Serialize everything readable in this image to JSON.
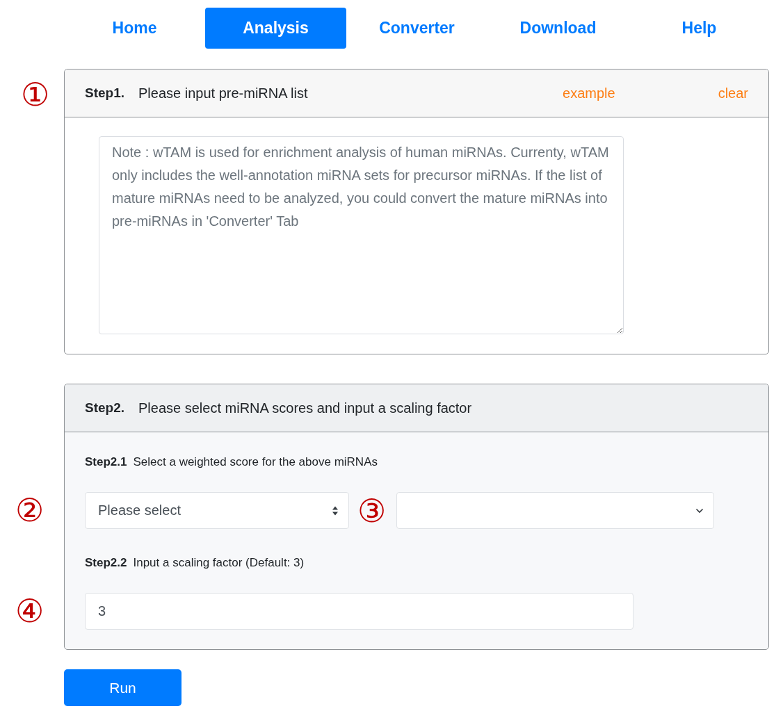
{
  "nav": {
    "tabs": [
      {
        "label": "Home",
        "selected": false
      },
      {
        "label": "Analysis",
        "selected": true
      },
      {
        "label": "Converter",
        "selected": false
      },
      {
        "label": "Download",
        "selected": false
      },
      {
        "label": "Help",
        "selected": false
      }
    ]
  },
  "step1": {
    "marker": "①",
    "step": "Step1.",
    "title": "Please input pre-miRNA list",
    "links": [
      "example",
      "clear"
    ],
    "textarea": {
      "placeholder": "Note : wTAM is used for enrichment analysis of human miRNAs. Currenty, wTAM only includes the well-annotation miRNA sets for precursor miRNAs. If the list of mature miRNAs need to be analyzed, you could convert the mature miRNAs into pre-miRNAs in 'Converter' Tab"
    }
  },
  "step2": {
    "step": "Step2.",
    "title": "Please select miRNA scores and input a scaling factor",
    "sub1": {
      "step": "Step2.1",
      "label": "Select a weighted score for the above miRNAs"
    },
    "select_1": {
      "marker": "②",
      "value": "Please select"
    },
    "select_2": {
      "marker": "③"
    },
    "sub2": {
      "step": "Step2.2",
      "label": "Input a scaling factor (Default: 3)"
    },
    "scaling_input": {
      "marker": "④",
      "value": "3"
    }
  },
  "run_button": {
    "label": "Run"
  }
}
